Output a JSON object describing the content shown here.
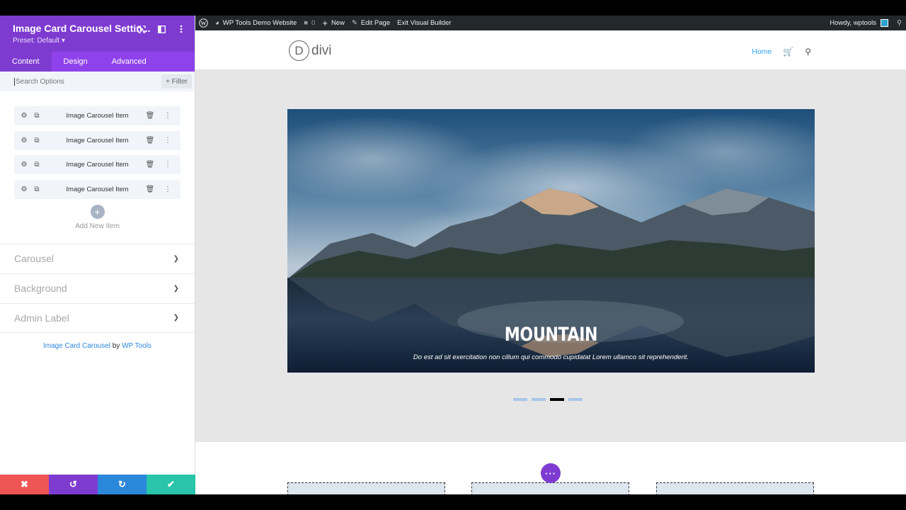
{
  "panel": {
    "title": "Image Card Carousel Settin...",
    "preset": "Preset: Default ▾",
    "tabs": [
      "Content",
      "Design",
      "Advanced"
    ],
    "search_placeholder": "Search Options",
    "filter_label": "+ Filter",
    "items": [
      {
        "label": "Image Carousel Item"
      },
      {
        "label": "Image Carousel Item"
      },
      {
        "label": "Image Carousel Item"
      },
      {
        "label": "Image Carousel Item"
      }
    ],
    "add_new_label": "Add New Item",
    "sections": [
      "Carousel",
      "Background",
      "Admin Label"
    ],
    "credit_plugin": "Image Card Carousel",
    "credit_by": " by ",
    "credit_author": "WP Tools",
    "colors": {
      "header": "#7e3bd0",
      "tabs": "#8f42ec",
      "cancel": "#ef5555",
      "undo": "#7e3bd0",
      "redo": "#2b87da",
      "save": "#29c4a9"
    }
  },
  "adminbar": {
    "site_name": "WP Tools Demo Website",
    "comments_count": "0",
    "new_label": "New",
    "edit_page_label": "Edit Page",
    "exit_label": "Exit Visual Builder",
    "howdy": "Howdy, wptools"
  },
  "site": {
    "logo_letter": "D",
    "logo_text": "divi",
    "nav_home": "Home",
    "slide_title": "MOUNTAIN",
    "slide_desc": "Do est ad sit exercitation non cillum qui commodo cupidatat Lorem ullamco sit reprehenderit.",
    "carousel_dots": 4,
    "active_dot": 3
  }
}
